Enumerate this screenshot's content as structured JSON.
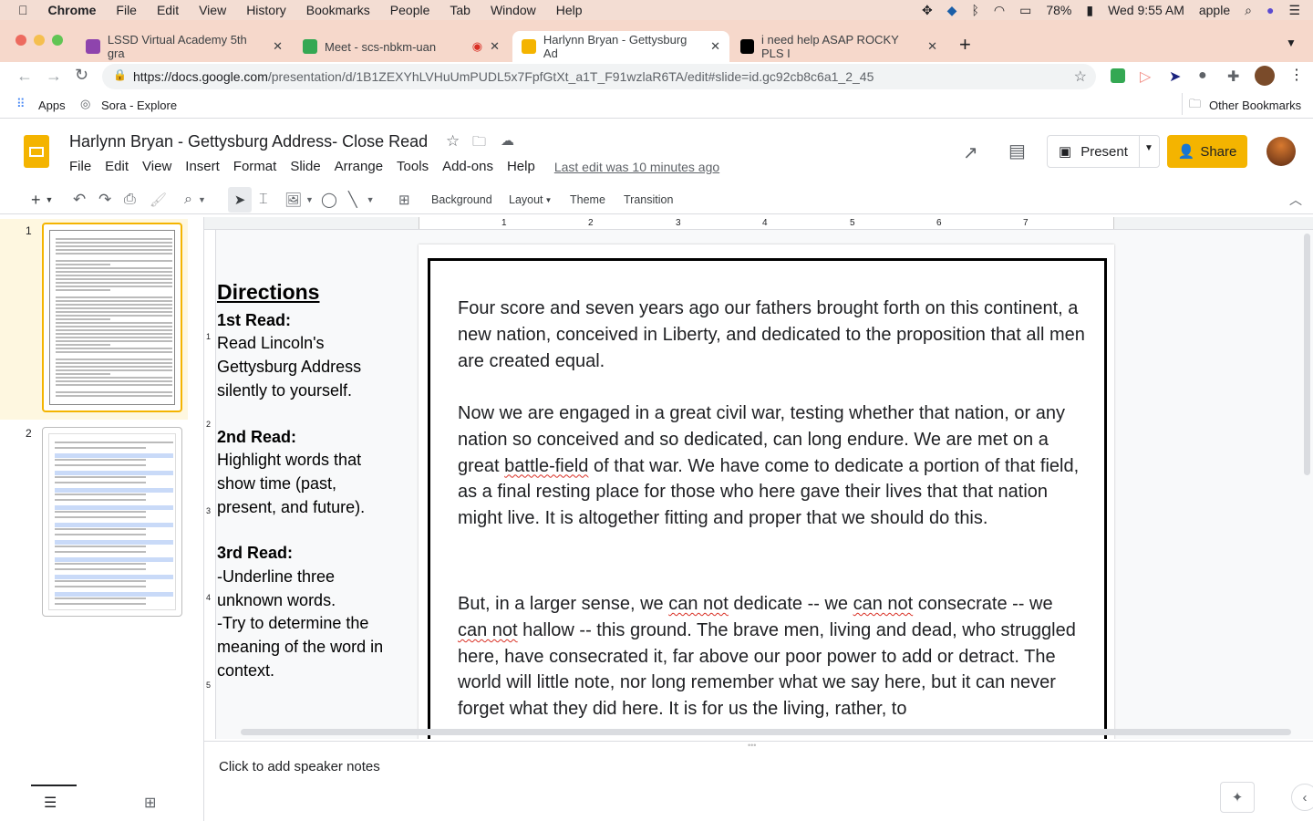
{
  "menubar": {
    "app": "Chrome",
    "items": [
      "File",
      "Edit",
      "View",
      "History",
      "Bookmarks",
      "People",
      "Tab",
      "Window",
      "Help"
    ],
    "battery": "78%",
    "clock": "Wed 9:55 AM",
    "user": "apple"
  },
  "tabs": [
    {
      "title": "LSSD Virtual Academy 5th gra",
      "color": "#8e44ad"
    },
    {
      "title": "Meet - scs-nbkm-uan",
      "color": "#34a853"
    },
    {
      "title": "Harlynn Bryan - Gettysburg Ad",
      "color": "#f4b400"
    },
    {
      "title": "i need help ASAP ROCKY PLS I",
      "color": "#000000"
    }
  ],
  "address": {
    "host": "https://docs.google.com",
    "path": "/presentation/d/1B1ZEXYhLVHuUmPUDL5x7FpfGtXt_a1T_F91wzlaR6TA/edit#slide=id.gc92cb8c6a1_2_45"
  },
  "bookmarks": {
    "apps": "Apps",
    "items": [
      "Sora - Explore"
    ],
    "other": "Other Bookmarks"
  },
  "doc": {
    "title": "Harlynn Bryan - Gettysburg Address- Close Read",
    "menus": [
      "File",
      "Edit",
      "View",
      "Insert",
      "Format",
      "Slide",
      "Arrange",
      "Tools",
      "Add-ons",
      "Help"
    ],
    "last_edit": "Last edit was 10 minutes ago",
    "present": "Present",
    "share": "Share"
  },
  "toolbar": {
    "background": "Background",
    "layout": "Layout",
    "theme": "Theme",
    "transition": "Transition"
  },
  "ruler": [
    "1",
    "2",
    "3",
    "4",
    "5",
    "6",
    "7"
  ],
  "vruler": [
    "1",
    "2",
    "3",
    "4",
    "5"
  ],
  "slides": [
    {
      "num": "1"
    },
    {
      "num": "2"
    }
  ],
  "directions": {
    "heading": "Directions",
    "r1": "1st Read:",
    "r1t": "Read Lincoln's Gettysburg Address silently to yourself.",
    "r2": "2nd Read:",
    "r2t": "Highlight words that show time (past, present, and future).",
    "r3": "3rd Read:",
    "r3a": "-Underline three unknown words.",
    "r3b": "-Try to determine the meaning of the word in context."
  },
  "slide_text": {
    "p1": "Four score and seven years ago our fathers brought forth on this continent, a new nation, conceived in Liberty, and dedicated to the proposition that all men are created equal.",
    "p2a": "Now we are engaged in a great civil war, testing whether that nation, or any nation so conceived and so dedicated, can long endure. We are met on a great ",
    "p2w": "battle-field",
    "p2b": " of that war. We have come to dedicate a portion of that field, as a final resting place for those who here gave their lives that that nation might live. It is altogether fitting and proper that we should do this.",
    "p3a": "But, in a larger sense, we ",
    "cn": "can not",
    "p3b": " dedicate -- we ",
    "p3c": " consecrate -- we ",
    "p3d": " hallow -- this ground. The brave men, living and dead, who struggled here, have consecrated it, far above our poor power to add or detract. The world will little note, nor long remember what we say here, but it can never forget what they did here. It is for us the living, rather, to"
  },
  "notes": "Click to add speaker notes"
}
